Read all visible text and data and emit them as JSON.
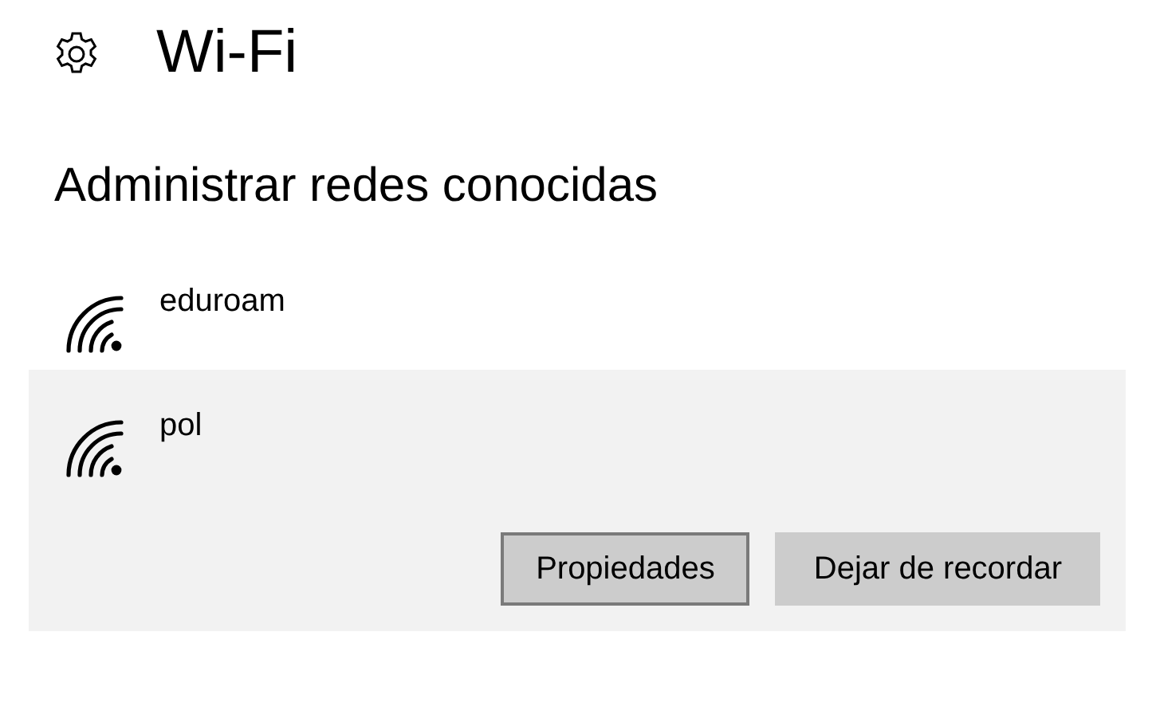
{
  "header": {
    "title": "Wi-Fi"
  },
  "section": {
    "title": "Administrar redes conocidas"
  },
  "networks": [
    {
      "name": "eduroam",
      "selected": false
    },
    {
      "name": "pol",
      "selected": true,
      "actions": [
        {
          "label": "Propiedades",
          "focused": true
        },
        {
          "label": "Dejar de recordar",
          "focused": false
        }
      ]
    }
  ]
}
